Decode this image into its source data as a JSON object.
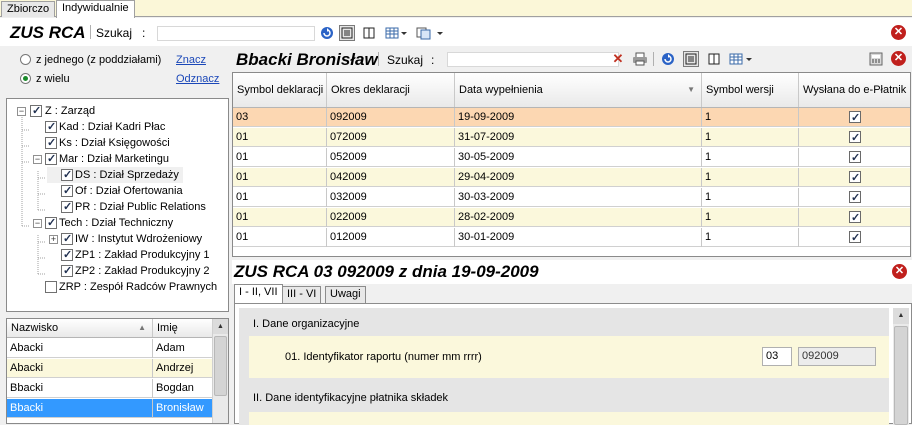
{
  "top_tabs": [
    "Zbiorczo",
    "Indywidualnie"
  ],
  "left_header": {
    "title": "ZUS RCA",
    "search_label": "Szukaj",
    "search_colon": ":"
  },
  "radio": {
    "opt1": "z jednego (z poddziałami)",
    "opt2": "z wielu",
    "link1": "Znacz",
    "link2": "Odznacz"
  },
  "tree": [
    {
      "label": "Z : Zarząd"
    },
    {
      "label": "Kad : Dział Kadri Płac"
    },
    {
      "label": "Ks : Dział Księgowości"
    },
    {
      "label": "Mar : Dział Marketingu"
    },
    {
      "label": "DS : Dział Sprzedaży"
    },
    {
      "label": "Of : Dział Ofertowania"
    },
    {
      "label": "PR : Dział Public Relations"
    },
    {
      "label": "Tech : Dział Techniczny"
    },
    {
      "label": "IW : Instytut Wdrożeniowy"
    },
    {
      "label": "ZP1 : Zakład Produkcyjny 1"
    },
    {
      "label": "ZP2 : Zakład Produkcyjny 2"
    },
    {
      "label": "ZRP : Zespół Radców Prawnych"
    }
  ],
  "people": {
    "headers": [
      "Nazwisko",
      "Imię"
    ],
    "rows": [
      [
        "Abacki",
        "Adam"
      ],
      [
        "Abacki",
        "Andrzej"
      ],
      [
        "Bbacki",
        "Bogdan"
      ],
      [
        "Bbacki",
        "Bronisław"
      ],
      [
        "",
        ""
      ]
    ]
  },
  "main_header": {
    "title": "Bbacki Bronisław",
    "search_label": "Szukaj",
    "search_colon": ":"
  },
  "decl": {
    "headers": [
      "Symbol deklaracji",
      "Okres deklaracji",
      "Data wypełnienia",
      "Symbol wersji",
      "Wysłana do e-Płatnik"
    ],
    "rows": [
      [
        "03",
        "092009",
        "19-09-2009",
        "1"
      ],
      [
        "01",
        "072009",
        "31-07-2009",
        "1"
      ],
      [
        "01",
        "052009",
        "30-05-2009",
        "1"
      ],
      [
        "01",
        "042009",
        "29-04-2009",
        "1"
      ],
      [
        "01",
        "032009",
        "30-03-2009",
        "1"
      ],
      [
        "01",
        "022009",
        "28-02-2009",
        "1"
      ],
      [
        "01",
        "012009",
        "30-01-2009",
        "1"
      ]
    ]
  },
  "form": {
    "title": "ZUS RCA 03 092009 z dnia 19-09-2009",
    "tabs": [
      "I - II, VII",
      "III - VI",
      "Uwagi"
    ],
    "section1": "I. Dane organizacyjne",
    "field1_label": "01. Identyfikator raportu (numer mm rrrr)",
    "field1_num": "03",
    "field1_period": "092009",
    "section2": "II. Dane identyfikacyjne płatnika składek"
  },
  "colors": {
    "selected_row": "#fcd7b2",
    "alt_row": "#fbf8dc",
    "blue_row": "#3399ff",
    "close_red": "#c0201d"
  },
  "icons": [
    "close-icon",
    "refresh-icon",
    "grid-view-icon",
    "split-view-icon",
    "table-icon",
    "copy-icon",
    "delete-icon",
    "print-icon",
    "calculator-icon",
    "sort-down-icon"
  ]
}
